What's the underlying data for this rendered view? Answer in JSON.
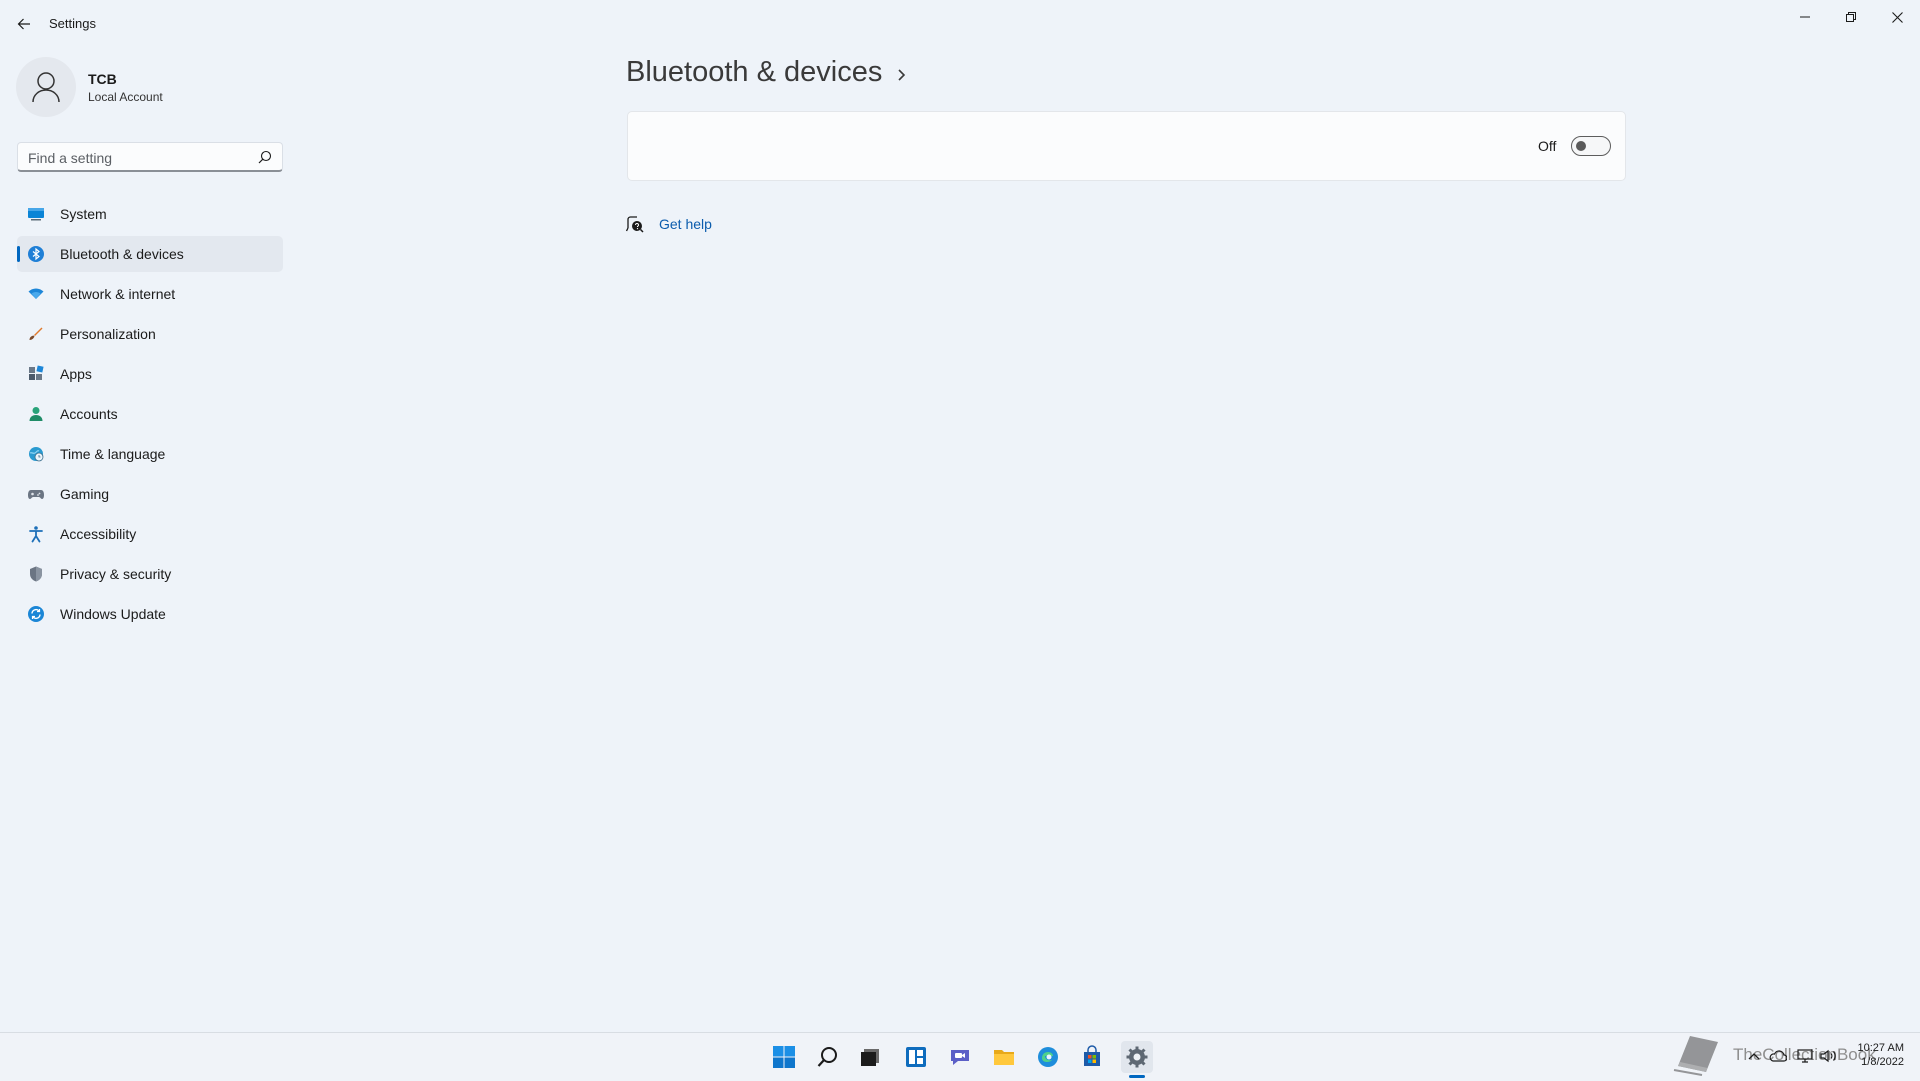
{
  "window": {
    "title": "Settings"
  },
  "user": {
    "name": "TCB",
    "account_type": "Local Account"
  },
  "search": {
    "placeholder": "Find a setting"
  },
  "sidebar": {
    "items": [
      {
        "label": "System",
        "icon": "monitor-icon"
      },
      {
        "label": "Bluetooth & devices",
        "icon": "bluetooth-icon",
        "selected": true
      },
      {
        "label": "Network & internet",
        "icon": "wifi-icon"
      },
      {
        "label": "Personalization",
        "icon": "brush-icon"
      },
      {
        "label": "Apps",
        "icon": "apps-icon"
      },
      {
        "label": "Accounts",
        "icon": "person-icon"
      },
      {
        "label": "Time & language",
        "icon": "globe-clock-icon"
      },
      {
        "label": "Gaming",
        "icon": "gamepad-icon"
      },
      {
        "label": "Accessibility",
        "icon": "accessibility-icon"
      },
      {
        "label": "Privacy & security",
        "icon": "shield-icon"
      },
      {
        "label": "Windows Update",
        "icon": "sync-icon"
      }
    ]
  },
  "main": {
    "title": "Bluetooth & devices",
    "toggle": {
      "state_label": "Off",
      "on": false
    },
    "help_link": "Get help"
  },
  "taskbar": {
    "apps": [
      "start-icon",
      "search-icon",
      "task-view-icon",
      "widgets-icon",
      "chat-icon",
      "file-explorer-icon",
      "edge-icon",
      "store-icon",
      "settings-icon"
    ],
    "active_app": "settings-icon",
    "watermark": "TheCollectionBook",
    "clock": {
      "time": "10:27 AM",
      "date": "1/8/2022"
    }
  },
  "colors": {
    "accent": "#0067c0",
    "background": "#eef3f9",
    "link": "#0b5cad"
  }
}
